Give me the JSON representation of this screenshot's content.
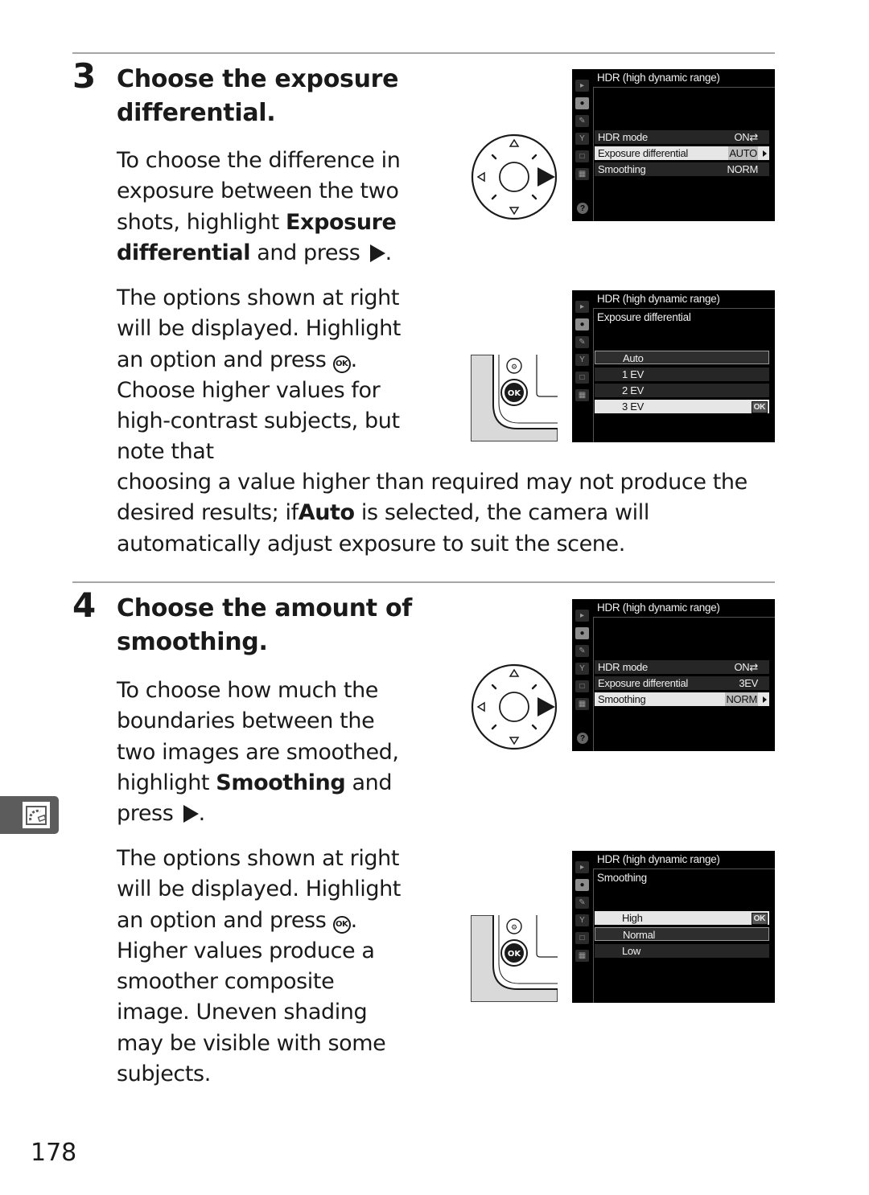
{
  "page_number": "178",
  "side_tab_icon": "shooting-menu-hdr-icon",
  "steps": [
    {
      "number": "3",
      "title": "Choose the exposure differential.",
      "instruction": {
        "t1": "To choose the difference in exposure between the two shots, highlight ",
        "b1": "Exposure differential",
        "t2": " and press",
        "t3": "."
      },
      "detail": {
        "t1": "The options shown at right will be displayed. Highlight an option and press",
        "t2": ". Choose higher values for high-contrast subjects, but note that choosing a value higher than required may not produce the desired results; if ",
        "b1": "Auto",
        "t3": " is selected, the camera will automatically adjust exposure to suit the scene."
      },
      "screens": [
        {
          "title": "HDR (high dynamic range)",
          "rows": [
            {
              "label": "HDR mode",
              "value": "ON⇄"
            },
            {
              "label": "Exposure differential",
              "value": "AUTO",
              "selected": true
            },
            {
              "label": "Smoothing",
              "value": "NORM"
            }
          ]
        },
        {
          "title": "HDR (high dynamic range)",
          "subtitle": "Exposure differential",
          "options": [
            "Auto",
            "1 EV",
            "2 EV",
            "3 EV"
          ],
          "outlined_option": "Auto",
          "selected_option": "3 EV",
          "ok_badge": "OK"
        }
      ]
    },
    {
      "number": "4",
      "title": "Choose the amount of smoothing.",
      "instruction": {
        "t1": "To choose how much the boundaries between the two images are smoothed, highlight ",
        "b1": "Smoothing",
        "t2": " and press",
        "t3": "."
      },
      "detail": {
        "t1": "The options shown at right will be displayed. Highlight an option and press",
        "t2": ". Higher values produce a smoother composite image. Uneven shading may be visible with some subjects."
      },
      "screens": [
        {
          "title": "HDR (high dynamic range)",
          "rows": [
            {
              "label": "HDR mode",
              "value": "ON⇄"
            },
            {
              "label": "Exposure differential",
              "value": "3EV"
            },
            {
              "label": "Smoothing",
              "value": "NORM",
              "selected": true
            }
          ]
        },
        {
          "title": "HDR (high dynamic range)",
          "subtitle": "Smoothing",
          "options": [
            "High",
            "Normal",
            "Low"
          ],
          "outlined_option": "Normal",
          "selected_option": "High",
          "ok_badge": "OK"
        }
      ]
    }
  ],
  "glyphs": {
    "ok": "OK",
    "help": "?",
    "zoom_out_button": "⊖"
  }
}
